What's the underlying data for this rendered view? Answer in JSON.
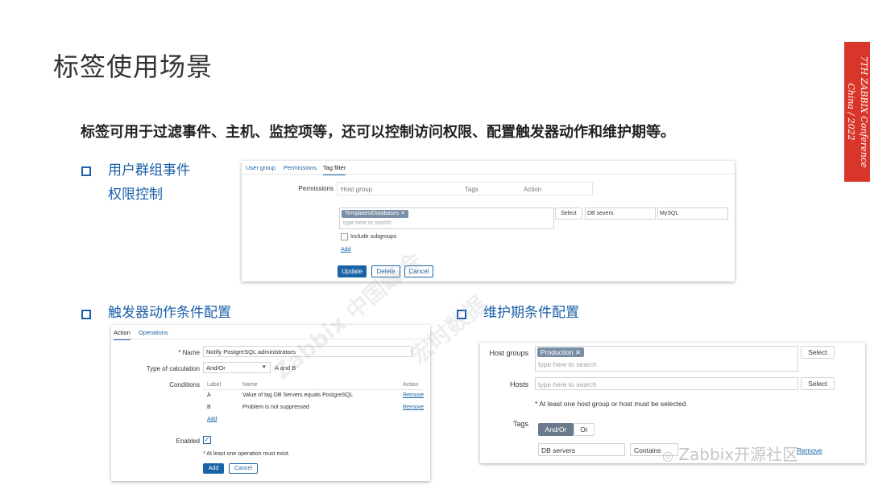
{
  "slide": {
    "title": "标签使用场景",
    "subtitle": "标签可用于过滤事件、主机、监控项等，还可以控制访问权限、配置触发器动作和维护期等。",
    "bullets": [
      {
        "line1": "用户群组事件",
        "line2": "权限控制"
      },
      {
        "line1": "触发器动作条件配置"
      },
      {
        "line1": "维护期条件配置"
      }
    ],
    "conference": {
      "line1": "7TH ZABBIX Conference",
      "line2": "China / 2022"
    },
    "watermark1": "Zabbix 中国峰会",
    "watermark2": "宏时数据",
    "footer_brand": "Zabbix开源社区"
  },
  "panel_usergroup": {
    "tabs": [
      "User group",
      "Permissions",
      "Tag filter"
    ],
    "permissions_label": "Permissions",
    "col_host_group": "Host group",
    "col_tags": "Tags",
    "col_action": "Action",
    "chip": "Templates/Databases",
    "placeholder": "type here to search",
    "select_label": "Select",
    "tag_value1": "DB severs",
    "tag_value2": "MySQL",
    "include_subgroups": "Include subgroups",
    "add": "Add",
    "update": "Update",
    "delete": "Delete",
    "cancel": "Cancel"
  },
  "panel_action": {
    "tabs": [
      "Action",
      "Operations"
    ],
    "name_label": "* Name",
    "name_value": "Notify PostgreSQL administrators",
    "calc_label": "Type of calculation",
    "calc_value": "And/Or",
    "calc_result": "A and B",
    "conditions_label": "Conditions",
    "col_label": "Label",
    "col_name": "Name",
    "col_action": "Action",
    "rows": [
      {
        "label": "A",
        "name": "Value of tag DB Servers equals PostgreSQL",
        "action": "Remove"
      },
      {
        "label": "B",
        "name": "Problem is not suppressed",
        "action": "Remove"
      }
    ],
    "add": "Add",
    "enabled_label": "Enabled",
    "note": "* At least one operation must exist.",
    "add_btn": "Add",
    "cancel_btn": "Cancel"
  },
  "panel_maintenance": {
    "host_groups_label": "Host groups",
    "chip": "Production",
    "placeholder": "type here to search",
    "select_label": "Select",
    "hosts_label": "Hosts",
    "hosts_placeholder": "type here to search",
    "warning": "* At least one host group or host must be selected.",
    "tags_label": "Tags",
    "andor": "And/Or",
    "or": "Or",
    "tag_value": "DB servers",
    "operator": "Contains",
    "remove": "Remove"
  }
}
